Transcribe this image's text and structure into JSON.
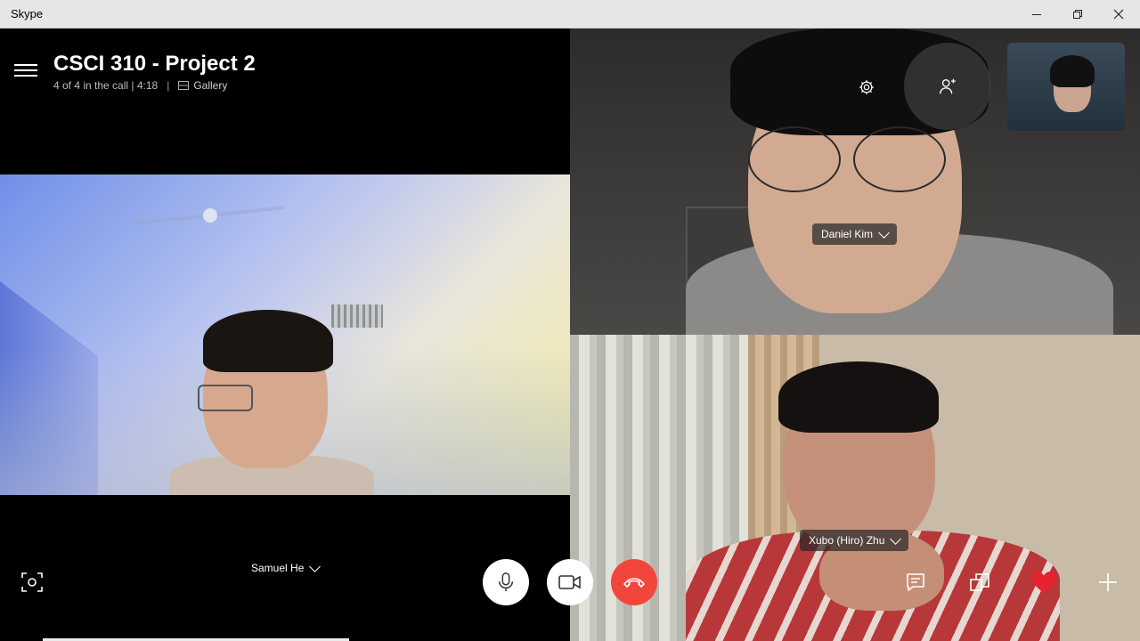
{
  "window": {
    "title": "Skype"
  },
  "call": {
    "title": "CSCI 310 - Project 2",
    "status": "4 of 4 in the call | 4:18",
    "separator": "|",
    "view_mode": "Gallery"
  },
  "participants": [
    {
      "name": "Samuel He"
    },
    {
      "name": "Daniel Kim"
    },
    {
      "name": "Xubo (Hiro) Zhu"
    }
  ],
  "controls": {
    "mic": "microphone-icon",
    "video": "video-camera-icon",
    "hangup": "hang-up-icon",
    "snapshot": "snapshot-icon",
    "chat": "chat-icon",
    "switch_camera": "switch-camera-icon",
    "react": "heart-icon",
    "more": "plus-icon",
    "settings": "gear-icon",
    "add_people": "add-person-icon"
  },
  "colors": {
    "hangup": "#f2463c",
    "heart": "#e8232e",
    "background": "#000000",
    "titlebar": "#e6e6e6"
  }
}
